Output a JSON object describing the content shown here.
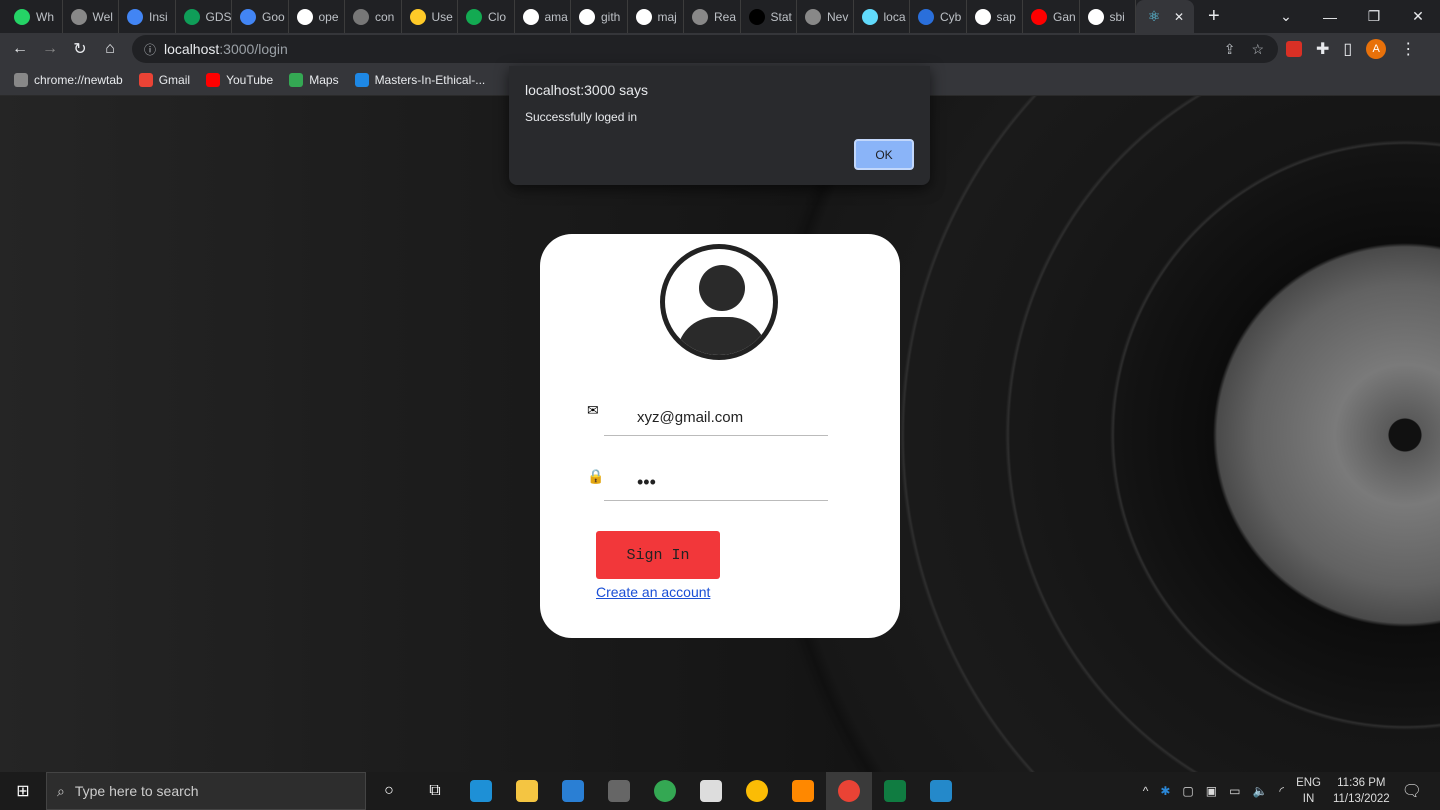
{
  "browser": {
    "tabs": [
      {
        "label": "Wh",
        "icon": "whatsapp-icon",
        "color": "#25d366"
      },
      {
        "label": "Wel",
        "icon": "globe-icon",
        "color": "#888"
      },
      {
        "label": "Insi",
        "icon": "google-cloud-icon",
        "color": "#4285f4"
      },
      {
        "label": "GDS",
        "icon": "sheets-icon",
        "color": "#0f9d58"
      },
      {
        "label": "Goo",
        "icon": "google-cloud-icon",
        "color": "#4285f4"
      },
      {
        "label": "ope",
        "icon": "github-icon",
        "color": "#fff"
      },
      {
        "label": "con",
        "icon": "document-icon",
        "color": "#777"
      },
      {
        "label": "Use",
        "icon": "firebase-icon",
        "color": "#ffca28"
      },
      {
        "label": "Clo",
        "icon": "mongodb-icon",
        "color": "#13aa52"
      },
      {
        "label": "ama",
        "icon": "github-icon",
        "color": "#fff"
      },
      {
        "label": "gith",
        "icon": "github-icon",
        "color": "#fff"
      },
      {
        "label": "maj",
        "icon": "google-icon",
        "color": "#fff"
      },
      {
        "label": "Rea",
        "icon": "globe-icon",
        "color": "#888"
      },
      {
        "label": "Stat",
        "icon": "medium-icon",
        "color": "#000"
      },
      {
        "label": "Nev",
        "icon": "chrome-icon",
        "color": "#888"
      },
      {
        "label": "loca",
        "icon": "react-icon",
        "color": "#61dafb"
      },
      {
        "label": "Cyb",
        "icon": "bookmark-icon",
        "color": "#2a6fdb"
      },
      {
        "label": "sap",
        "icon": "google-icon",
        "color": "#fff"
      },
      {
        "label": "Gan",
        "icon": "youtube-icon",
        "color": "#ff0000"
      },
      {
        "label": "sbi",
        "icon": "google-icon",
        "color": "#fff"
      }
    ],
    "active_tab": {
      "icon": "react-icon",
      "close": "✕"
    },
    "new_tab": "+",
    "url_host": "localhost",
    "url_rest": ":3000/login",
    "profile_initial": "A",
    "bookmarks": [
      {
        "label": "chrome://newtab",
        "color": "#888"
      },
      {
        "label": "Gmail",
        "color": "#ea4335"
      },
      {
        "label": "YouTube",
        "color": "#ff0000"
      },
      {
        "label": "Maps",
        "color": "#34a853"
      },
      {
        "label": "Masters-In-Ethical-...",
        "color": "#1e88e5"
      }
    ]
  },
  "dialog": {
    "title": "localhost:3000 says",
    "message": "Successfully loged in",
    "ok": "OK"
  },
  "login": {
    "email": "xyz@gmail.com",
    "password": "•••",
    "signin": "Sign In",
    "create": "Create an account"
  },
  "taskbar": {
    "search_placeholder": "Type here to search",
    "lang1": "ENG",
    "lang2": "IN",
    "time": "11:36 PM",
    "date": "11/13/2022",
    "apps": [
      {
        "name": "edge",
        "color": "#1e90d6"
      },
      {
        "name": "file-explorer",
        "color": "#f4c542"
      },
      {
        "name": "mail",
        "color": "#2a7fd4"
      },
      {
        "name": "calculator",
        "color": "#666"
      },
      {
        "name": "chrome",
        "color": "#34a853"
      },
      {
        "name": "media",
        "color": "#ddd"
      },
      {
        "name": "chrome",
        "color": "#fbbc05"
      },
      {
        "name": "vlc",
        "color": "#ff8800"
      },
      {
        "name": "chrome",
        "color": "#ea4335"
      },
      {
        "name": "excel",
        "color": "#107c41"
      },
      {
        "name": "vscode",
        "color": "#2489ca"
      }
    ]
  }
}
